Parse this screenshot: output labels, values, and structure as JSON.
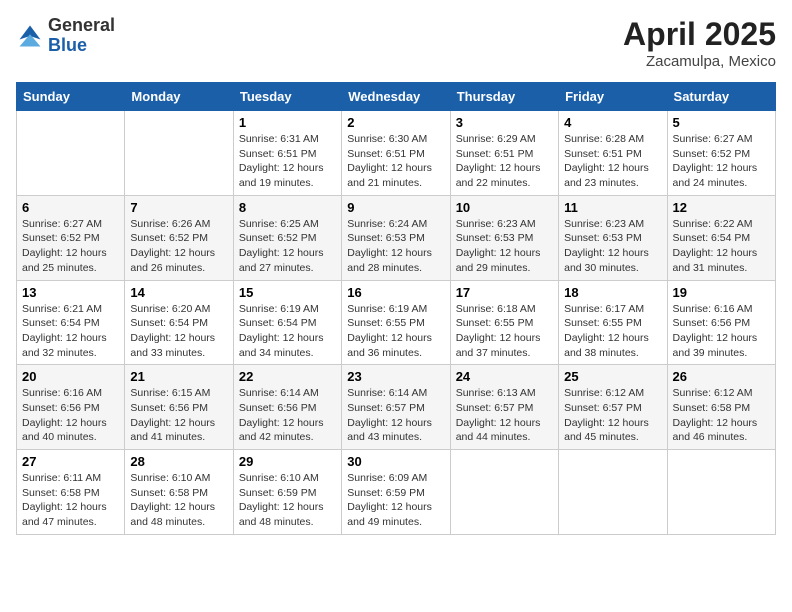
{
  "header": {
    "logo_general": "General",
    "logo_blue": "Blue",
    "month_title": "April 2025",
    "location": "Zacamulpa, Mexico"
  },
  "days_of_week": [
    "Sunday",
    "Monday",
    "Tuesday",
    "Wednesday",
    "Thursday",
    "Friday",
    "Saturday"
  ],
  "weeks": [
    [
      {
        "day": "",
        "info": ""
      },
      {
        "day": "",
        "info": ""
      },
      {
        "day": "1",
        "info": "Sunrise: 6:31 AM\nSunset: 6:51 PM\nDaylight: 12 hours and 19 minutes."
      },
      {
        "day": "2",
        "info": "Sunrise: 6:30 AM\nSunset: 6:51 PM\nDaylight: 12 hours and 21 minutes."
      },
      {
        "day": "3",
        "info": "Sunrise: 6:29 AM\nSunset: 6:51 PM\nDaylight: 12 hours and 22 minutes."
      },
      {
        "day": "4",
        "info": "Sunrise: 6:28 AM\nSunset: 6:51 PM\nDaylight: 12 hours and 23 minutes."
      },
      {
        "day": "5",
        "info": "Sunrise: 6:27 AM\nSunset: 6:52 PM\nDaylight: 12 hours and 24 minutes."
      }
    ],
    [
      {
        "day": "6",
        "info": "Sunrise: 6:27 AM\nSunset: 6:52 PM\nDaylight: 12 hours and 25 minutes."
      },
      {
        "day": "7",
        "info": "Sunrise: 6:26 AM\nSunset: 6:52 PM\nDaylight: 12 hours and 26 minutes."
      },
      {
        "day": "8",
        "info": "Sunrise: 6:25 AM\nSunset: 6:52 PM\nDaylight: 12 hours and 27 minutes."
      },
      {
        "day": "9",
        "info": "Sunrise: 6:24 AM\nSunset: 6:53 PM\nDaylight: 12 hours and 28 minutes."
      },
      {
        "day": "10",
        "info": "Sunrise: 6:23 AM\nSunset: 6:53 PM\nDaylight: 12 hours and 29 minutes."
      },
      {
        "day": "11",
        "info": "Sunrise: 6:23 AM\nSunset: 6:53 PM\nDaylight: 12 hours and 30 minutes."
      },
      {
        "day": "12",
        "info": "Sunrise: 6:22 AM\nSunset: 6:54 PM\nDaylight: 12 hours and 31 minutes."
      }
    ],
    [
      {
        "day": "13",
        "info": "Sunrise: 6:21 AM\nSunset: 6:54 PM\nDaylight: 12 hours and 32 minutes."
      },
      {
        "day": "14",
        "info": "Sunrise: 6:20 AM\nSunset: 6:54 PM\nDaylight: 12 hours and 33 minutes."
      },
      {
        "day": "15",
        "info": "Sunrise: 6:19 AM\nSunset: 6:54 PM\nDaylight: 12 hours and 34 minutes."
      },
      {
        "day": "16",
        "info": "Sunrise: 6:19 AM\nSunset: 6:55 PM\nDaylight: 12 hours and 36 minutes."
      },
      {
        "day": "17",
        "info": "Sunrise: 6:18 AM\nSunset: 6:55 PM\nDaylight: 12 hours and 37 minutes."
      },
      {
        "day": "18",
        "info": "Sunrise: 6:17 AM\nSunset: 6:55 PM\nDaylight: 12 hours and 38 minutes."
      },
      {
        "day": "19",
        "info": "Sunrise: 6:16 AM\nSunset: 6:56 PM\nDaylight: 12 hours and 39 minutes."
      }
    ],
    [
      {
        "day": "20",
        "info": "Sunrise: 6:16 AM\nSunset: 6:56 PM\nDaylight: 12 hours and 40 minutes."
      },
      {
        "day": "21",
        "info": "Sunrise: 6:15 AM\nSunset: 6:56 PM\nDaylight: 12 hours and 41 minutes."
      },
      {
        "day": "22",
        "info": "Sunrise: 6:14 AM\nSunset: 6:56 PM\nDaylight: 12 hours and 42 minutes."
      },
      {
        "day": "23",
        "info": "Sunrise: 6:14 AM\nSunset: 6:57 PM\nDaylight: 12 hours and 43 minutes."
      },
      {
        "day": "24",
        "info": "Sunrise: 6:13 AM\nSunset: 6:57 PM\nDaylight: 12 hours and 44 minutes."
      },
      {
        "day": "25",
        "info": "Sunrise: 6:12 AM\nSunset: 6:57 PM\nDaylight: 12 hours and 45 minutes."
      },
      {
        "day": "26",
        "info": "Sunrise: 6:12 AM\nSunset: 6:58 PM\nDaylight: 12 hours and 46 minutes."
      }
    ],
    [
      {
        "day": "27",
        "info": "Sunrise: 6:11 AM\nSunset: 6:58 PM\nDaylight: 12 hours and 47 minutes."
      },
      {
        "day": "28",
        "info": "Sunrise: 6:10 AM\nSunset: 6:58 PM\nDaylight: 12 hours and 48 minutes."
      },
      {
        "day": "29",
        "info": "Sunrise: 6:10 AM\nSunset: 6:59 PM\nDaylight: 12 hours and 48 minutes."
      },
      {
        "day": "30",
        "info": "Sunrise: 6:09 AM\nSunset: 6:59 PM\nDaylight: 12 hours and 49 minutes."
      },
      {
        "day": "",
        "info": ""
      },
      {
        "day": "",
        "info": ""
      },
      {
        "day": "",
        "info": ""
      }
    ]
  ]
}
